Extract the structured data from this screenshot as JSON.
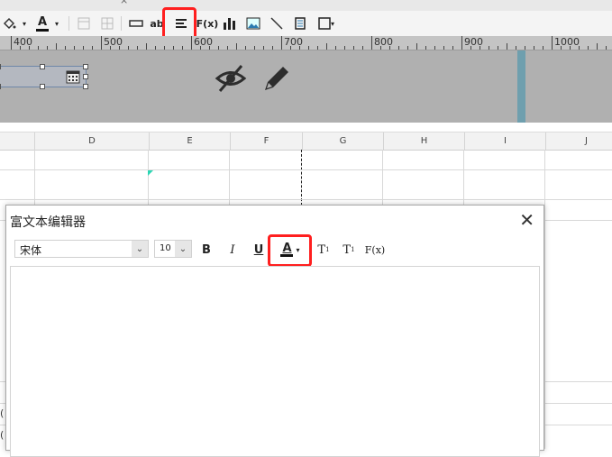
{
  "ruler": {
    "labels": [
      "400",
      "500",
      "600",
      "700",
      "800",
      "900",
      "1000"
    ]
  },
  "toolbar": {
    "icons": [
      "paint-bucket-icon",
      "font-color-icon",
      "border-icon",
      "grid-icon",
      "text-field-icon",
      "text-ab-icon",
      "align-left-icon",
      "formula-icon",
      "bar-chart-icon",
      "image-icon",
      "slash-icon",
      "frame-icon",
      "border-dropdown-icon"
    ],
    "text_ab_label": "ab",
    "formula_label": "F(x)"
  },
  "sheet": {
    "columns": [
      "D",
      "E",
      "F",
      "G",
      "H",
      "I",
      "J"
    ]
  },
  "dialog": {
    "title": "富文本编辑器",
    "font_family": "宋体",
    "font_size": "10",
    "bold_label": "B",
    "italic_label": "I",
    "underline_label": "U",
    "font_color_label": "A",
    "superscript_label": "T",
    "superscript_mark": "1",
    "subscript_label": "T",
    "subscript_mark": "1",
    "formula_label": "F(x)"
  },
  "colors": {
    "highlight": "#ff1f1f",
    "band": "#b0b0b0",
    "stripe": "#6f9fae"
  }
}
